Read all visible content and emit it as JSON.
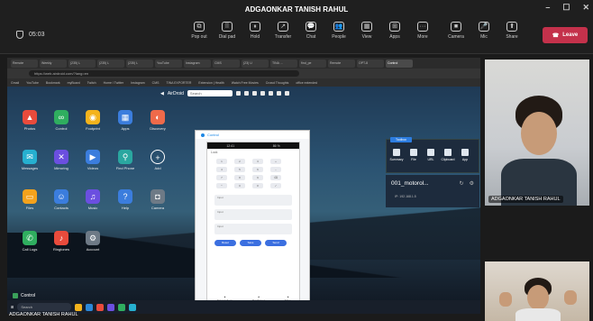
{
  "window": {
    "title": "ADGAONKAR TANISH RAHUL",
    "min": "–",
    "max": "☐",
    "close": "✕"
  },
  "toolbar": {
    "timer": "05:03",
    "tools": [
      {
        "id": "popout",
        "label": "Pop out",
        "glyph": "⧉"
      },
      {
        "id": "dialpad",
        "label": "Dial pad",
        "glyph": "⠿"
      },
      {
        "id": "hold",
        "label": "Hold",
        "glyph": "⏸"
      },
      {
        "id": "transfer",
        "label": "Transfer",
        "glyph": "↗"
      },
      {
        "id": "chat",
        "label": "Chat",
        "glyph": "💬"
      },
      {
        "id": "people",
        "label": "People",
        "glyph": "👥"
      },
      {
        "id": "view",
        "label": "View",
        "glyph": "▦"
      },
      {
        "id": "apps",
        "label": "Apps",
        "glyph": "⊞"
      },
      {
        "id": "more",
        "label": "More",
        "glyph": "···"
      },
      {
        "id": "camera",
        "label": "Camera",
        "glyph": "■"
      },
      {
        "id": "mic",
        "label": "Mic",
        "glyph": "🎤"
      },
      {
        "id": "share",
        "label": "Share",
        "glyph": "⬆"
      }
    ],
    "leave_label": "Leave",
    "leave_color": "#c4314b"
  },
  "browser": {
    "tabs": [
      "Remote",
      "Weekly",
      "(235) L",
      "(235) L",
      "(235) L",
      "YouTube",
      "Instagram",
      "CMS",
      "(23) U",
      "TINA ...",
      "find_pe",
      "Remote",
      "OPT-8",
      "Control"
    ],
    "active_tab": 13,
    "address": "https://web.airdroid.com/?lang=en",
    "bookmarks": [
      "Gmail",
      "YouTube",
      "Bookmark",
      "myBoard",
      "Twitch",
      "Home / Twitter",
      "Instagram",
      "CMS",
      "TINA EXPORTER",
      "Extension | Health",
      "Watch Free Movies",
      "Crowd Thoughts",
      "office extended"
    ]
  },
  "airdroid": {
    "brand": "AirDroid",
    "search_placeholder": "Search",
    "apps": [
      {
        "label": "Photos",
        "color": "#e94b3c",
        "glyph": "▲"
      },
      {
        "label": "Control",
        "color": "#2fae5f",
        "glyph": "∞"
      },
      {
        "label": "Footprint",
        "color": "#f4b31c",
        "glyph": "◉"
      },
      {
        "label": "Apps",
        "color": "#3b7ddd",
        "glyph": "▦"
      },
      {
        "label": "Discovery",
        "color": "#ef6a4a",
        "glyph": "◐"
      },
      {
        "label": "Messages",
        "color": "#26b0d0",
        "glyph": "✉"
      },
      {
        "label": "Mirroring",
        "color": "#6b4fe0",
        "glyph": "✕"
      },
      {
        "label": "Videos",
        "color": "#3b7ddd",
        "glyph": "▶"
      },
      {
        "label": "Find Phone",
        "color": "#2aa7a0",
        "glyph": "⚲"
      },
      {
        "label": "Add",
        "color": "transparent",
        "glyph": "+"
      },
      {
        "label": "Files",
        "color": "#f4a21c",
        "glyph": "▭"
      },
      {
        "label": "Contacts",
        "color": "#3b7ddd",
        "glyph": "☺"
      },
      {
        "label": "Music",
        "color": "#6b4fe0",
        "glyph": "♫"
      },
      {
        "label": "Help",
        "color": "#3b7ddd",
        "glyph": "?"
      },
      {
        "label": "Camera",
        "color": "#6e7a86",
        "glyph": "◘"
      },
      {
        "label": "Call Logs",
        "color": "#2fae5f",
        "glyph": "✆"
      },
      {
        "label": "Ringtones",
        "color": "#e94b3c",
        "glyph": "♪"
      },
      {
        "label": "Account",
        "color": "#6e7a86",
        "glyph": "⚙"
      }
    ],
    "control_window": {
      "title": "Control",
      "status_left": "12:41",
      "status_right": "86 %",
      "phone_title": "Lock",
      "keys": [
        "1",
        "2",
        "3",
        "+",
        "4",
        "5",
        "6",
        "−",
        "7",
        "8",
        "9",
        "⌫",
        "*",
        "0",
        "#",
        "✓"
      ],
      "fields": [
        "Input",
        "Input",
        "Input"
      ],
      "pills": [
        "Reset",
        "Save",
        "Send"
      ],
      "nav": [
        "Transactions",
        "Purchases",
        "More"
      ]
    },
    "panel": {
      "tab": "Toolbox",
      "icons": [
        "Summary",
        "File",
        "URL",
        "Clipboard",
        "App"
      ],
      "device_name": "001_motorol...",
      "device_sub": "IP: 192.168.1.5"
    },
    "taskbar_label": "Control",
    "search_box": "Search"
  },
  "participants": {
    "remote_name": "ADGAONKAR TANISH RAHUL",
    "self_name": "ADGAONKAR TANISH RAHUL"
  }
}
